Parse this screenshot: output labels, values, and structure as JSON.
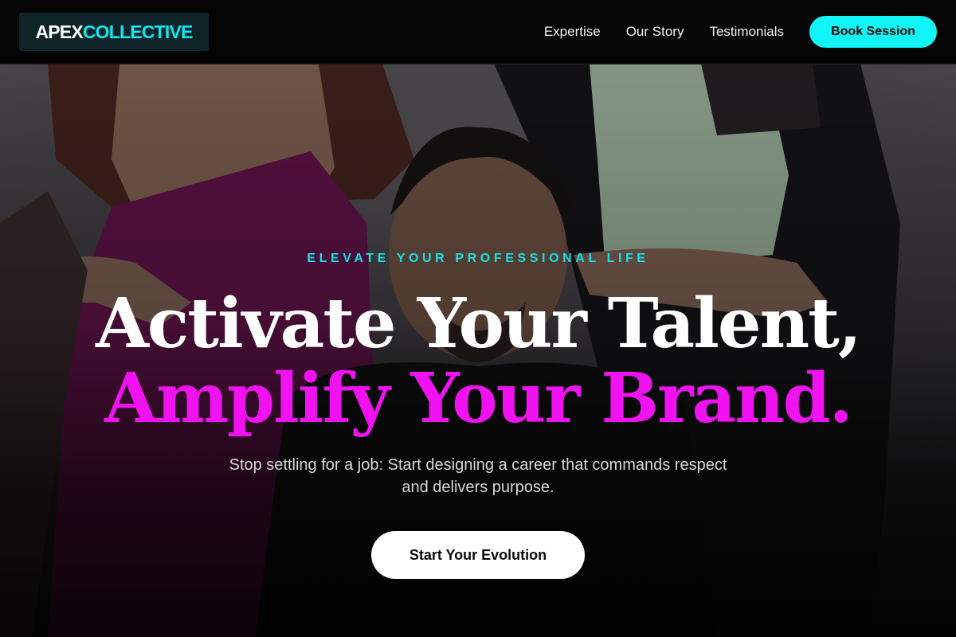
{
  "header": {
    "logo_part1": "APEX",
    "logo_part2": "COLLECTIVE",
    "nav": [
      "Expertise",
      "Our Story",
      "Testimonials"
    ],
    "cta": "Book Session"
  },
  "hero": {
    "eyebrow": "ELEVATE YOUR PROFESSIONAL LIFE",
    "headline_line1": "Activate Your Talent,",
    "headline_line2": "Amplify Your Brand.",
    "subtitle": "Stop settling for a job: Start designing a career that commands respect and delivers purpose.",
    "cta": "Start Your Evolution"
  },
  "colors": {
    "accent_cyan": "#13f4f7",
    "accent_magenta": "#f012f0",
    "header_bg": "#050506",
    "logo_bg": "#0e2428"
  }
}
